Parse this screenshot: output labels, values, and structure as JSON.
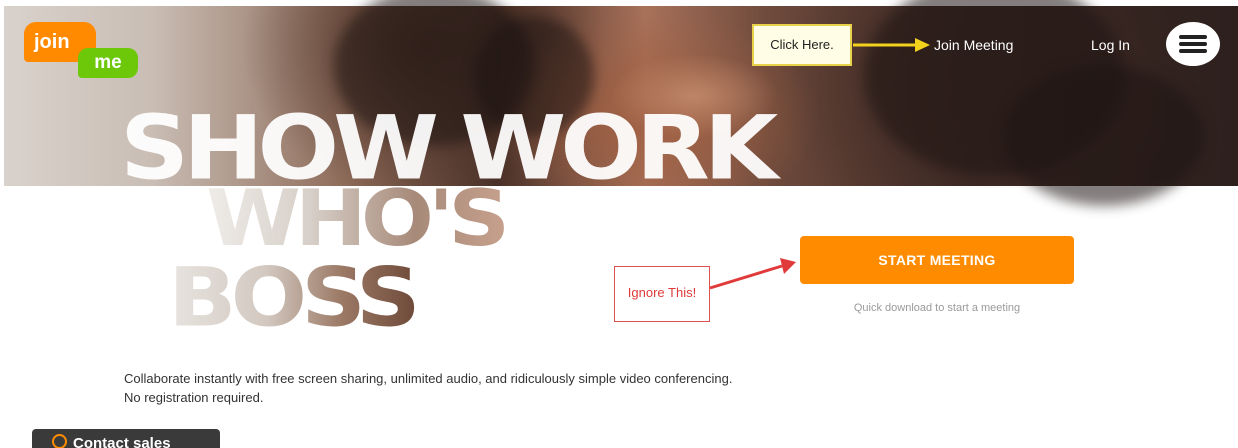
{
  "logo": {
    "part1": "join",
    "part2": "me",
    "colors": {
      "join": "#ff8a00",
      "me": "#6ec80a"
    }
  },
  "nav": {
    "join_meeting": "Join Meeting",
    "log_in": "Log In",
    "menu_icon": "hamburger-menu-icon"
  },
  "hero": {
    "line1": "SHOW WORK",
    "line2": "WHO'S",
    "line3": "BOSS"
  },
  "annotations": {
    "click_here": "Click Here.",
    "ignore_this": "Ignore This!",
    "colors": {
      "click": "#f2d21c",
      "ignore": "#e03a3a"
    }
  },
  "cta": {
    "label": "START MEETING",
    "sub": "Quick download to start a meeting",
    "color": "#ff8c00"
  },
  "tagline": "Collaborate instantly with free screen sharing, unlimited audio, and ridiculously simple video conferencing. No registration required.",
  "contact": {
    "label": "Contact sales",
    "icon": "chat-bubble-icon"
  }
}
